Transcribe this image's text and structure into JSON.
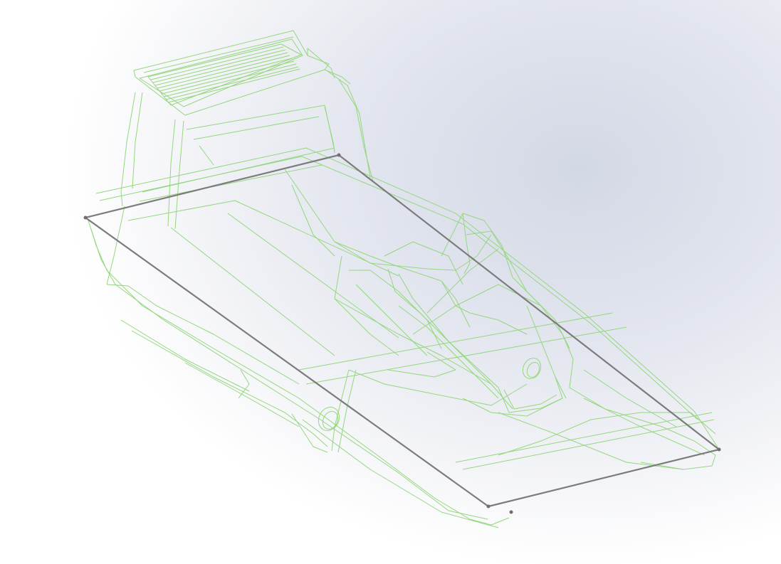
{
  "viewport": {
    "background": [
      "#d3d8e5",
      "#ffffff"
    ],
    "display_mode": "wireframe"
  },
  "model": {
    "type": "catamaran-boat",
    "wire_color": "#95d67f",
    "selected_sketch_color": "#7c7c7c",
    "selected_vertices": 4
  }
}
